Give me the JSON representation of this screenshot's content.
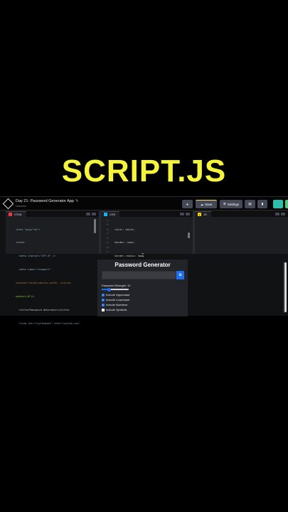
{
  "headline": "SCRIPT.JS",
  "project": {
    "title": "Day 21: Password Generator App",
    "author": "Unknown"
  },
  "toolbar": {
    "save_label": "Save",
    "settings_label": "Settings"
  },
  "panels": {
    "html": {
      "label": "HTML"
    },
    "css": {
      "label": "CSS"
    },
    "js": {
      "label": "JS"
    }
  },
  "html_code": [
    "<html lang=\"en\">",
    "<head>",
    "  <meta charset=\"UTF-8\" />",
    "  <meta name=\"viewport\"",
    "content=\"width=device-width, initial-",
    "scale=1.0\"/>",
    "  <title>Password Generator</title>",
    "  <link rel=\"stylesheet\" href=\"styles.css\""
  ],
  "css_line_numbers": [
    "14",
    "15",
    "16",
    "17",
    "18",
    "19",
    "20",
    "21"
  ],
  "css_code": [
    "  color: white;",
    "  border: none;",
    "  border-radius: 3px;",
    "  font-size: 1rem;",
    "  cursor: pointer;",
    "  background: #1d6ff2;",
    "}",
    ""
  ],
  "preview": {
    "title": "Password Generator",
    "copy_icon": "copy-icon",
    "length_label": "Password Strength: 12",
    "slider_value": 12,
    "slider_min": 4,
    "slider_max": 32,
    "options": [
      {
        "label": "Include Uppercase",
        "checked": true
      },
      {
        "label": "Include Lowercase",
        "checked": true
      },
      {
        "label": "Include Numbers",
        "checked": true
      },
      {
        "label": "Include Symbols",
        "checked": false
      }
    ]
  },
  "colors": {
    "headline": "#f4f43a",
    "accent_blue": "#1d6ff2",
    "save_accent": "#ffdd40",
    "html_tab": "#ff3c41",
    "css_tab": "#0ebeff",
    "js_tab": "#fcd000"
  }
}
